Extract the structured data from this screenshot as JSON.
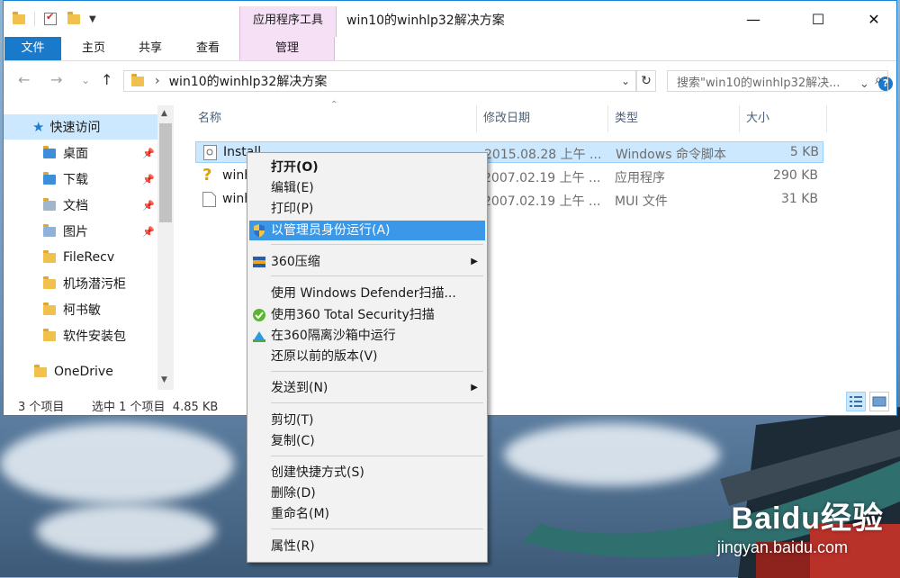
{
  "window": {
    "title": "win10的winhlp32解决方案",
    "context_tab_header": "应用程序工具",
    "minimize": "—",
    "maximize": "☐",
    "close": "✕"
  },
  "ribbon": {
    "tabs": [
      "文件",
      "主页",
      "共享",
      "查看",
      "管理"
    ],
    "expand": "⌄",
    "help": "?"
  },
  "nav": {
    "back": "←",
    "forward": "→",
    "recent": "⌄",
    "up": "↑",
    "address": "win10的winhlp32解决方案",
    "address_chevron": "›",
    "address_dropdown": "⌄",
    "refresh": "↻",
    "search_placeholder": "搜索\"win10的winhlp32解决..."
  },
  "sidebar": {
    "items": [
      {
        "label": "快速访问",
        "pinned": false
      },
      {
        "label": "桌面",
        "pinned": true
      },
      {
        "label": "下载",
        "pinned": true
      },
      {
        "label": "文档",
        "pinned": true
      },
      {
        "label": "图片",
        "pinned": true
      },
      {
        "label": "FileRecv",
        "pinned": false
      },
      {
        "label": "机场潜污柜",
        "pinned": false
      },
      {
        "label": "柯书敏",
        "pinned": false
      },
      {
        "label": "软件安装包",
        "pinned": false
      },
      {
        "label": "OneDrive",
        "pinned": false
      }
    ],
    "pin_glyph": "📌"
  },
  "columns": [
    "名称",
    "修改日期",
    "类型",
    "大小"
  ],
  "files": [
    {
      "name": "Install",
      "date": "2015.08.28 上午 ...",
      "type": "Windows 命令脚本",
      "size": "5 KB"
    },
    {
      "name": "winh",
      "date": "2007.02.19 上午 ...",
      "type": "应用程序",
      "size": "290 KB"
    },
    {
      "name": "winh",
      "date": "2007.02.19 上午 ...",
      "type": "MUI 文件",
      "size": "31 KB"
    }
  ],
  "status": {
    "count": "3 个项目",
    "selection": "选中 1 个项目  4.85 KB"
  },
  "context_menu": {
    "items": [
      "打开(O)",
      "编辑(E)",
      "打印(P)",
      "以管理员身份运行(A)",
      "360压缩",
      "使用 Windows Defender扫描...",
      "使用360 Total Security扫描",
      "在360隔离沙箱中运行",
      "还原以前的版本(V)",
      "发送到(N)",
      "剪切(T)",
      "复制(C)",
      "创建快捷方式(S)",
      "删除(D)",
      "重命名(M)",
      "属性(R)"
    ],
    "submenu_arrow": "▶"
  },
  "watermark": {
    "logo": "Baidu经验",
    "url": "jingyan.baidu.com"
  },
  "colors": {
    "accent": "#1979ca",
    "selection": "#cce8ff",
    "menu_highlight": "#3b98e8",
    "context_tab": "#f6e0f5"
  }
}
